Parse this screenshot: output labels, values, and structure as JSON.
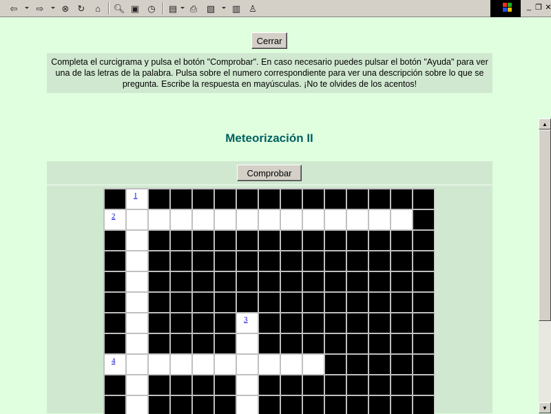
{
  "toolbar": {
    "icons": [
      "back-icon",
      "forward-icon",
      "stop-icon",
      "refresh-icon",
      "home-icon",
      "search-icon",
      "favorites-icon",
      "history-icon",
      "mail-icon",
      "print-icon",
      "edit-icon",
      "discuss-icon",
      "messenger-icon"
    ]
  },
  "buttons": {
    "close_label": "Cerrar",
    "check_label": "Comprobar"
  },
  "instructions": "Completa el curcigrama y pulsa el botón \"Comprobar\". En caso necesario puedes pulsar el botón \"Ayuda\" para ver una de las letras de la palabra. Pulsa sobre el numero correspondiente para ver una descripción sobre lo que se pregunta. Escribe la respuesta en mayúsculas. ¡No te olvides de los acentos!",
  "page_title": "Meteorización II",
  "crossword": {
    "columns": 15,
    "visible_rows": 11,
    "rows": [
      "B1BBBBBBBBBBBBB",
      "2WWWWWWWWWWWWWB",
      "BWBBBBBBBBBBBBB",
      "BWBBBBBBBBBBBBB",
      "BWBBBBBBBBBBBBB",
      "BWBBBBBBBBBBBBB",
      "BWBBBB3BBBBBBBB",
      "BWBBBBWBBBBBBBB",
      "4WWWWWWWWWBBBBB",
      "BWBBBBWBBBBBBBB",
      "BWBBBBWBBBBBBBB"
    ],
    "clue_numbers": [
      "1",
      "2",
      "3",
      "4"
    ]
  }
}
